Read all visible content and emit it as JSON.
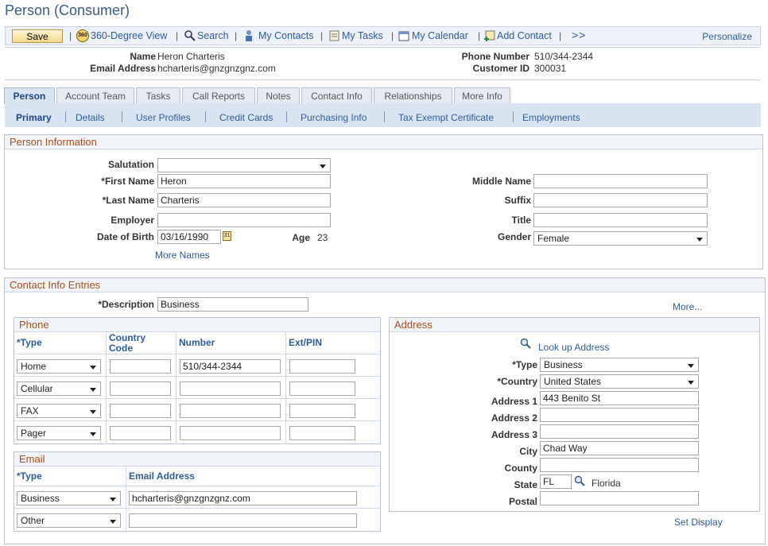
{
  "page": {
    "title": "Person (Consumer)"
  },
  "toolbar": {
    "save": "Save",
    "links": [
      {
        "label": "360-Degree View",
        "icon": "360-icon"
      },
      {
        "label": "Search",
        "icon": "search-icon"
      },
      {
        "label": "My Contacts",
        "icon": "contacts-icon"
      },
      {
        "label": "My Tasks",
        "icon": "tasks-icon"
      },
      {
        "label": "My Calendar",
        "icon": "calendar-icon"
      },
      {
        "label": "Add Contact",
        "icon": "add-contact-icon"
      }
    ],
    "more": ">>",
    "personalize": "Personalize"
  },
  "header": {
    "name_label": "Name",
    "name": "Heron Charteris",
    "email_label": "Email Address",
    "email": "hcharteris@gnzgnzgnz.com",
    "phone_label": "Phone Number",
    "phone": "510/344-2344",
    "customer_label": "Customer ID",
    "customer_id": "300031"
  },
  "tabs": [
    "Person",
    "Account Team",
    "Tasks",
    "Call Reports",
    "Notes",
    "Contact Info",
    "Relationships",
    "More Info"
  ],
  "subtabs": [
    "Primary",
    "Details",
    "User Profiles",
    "Credit Cards",
    "Purchasing Info",
    "Tax Exempt Certificate",
    "Employments"
  ],
  "person_info": {
    "heading": "Person Information",
    "salutation_label": "Salutation",
    "salutation": "",
    "first_name_label": "*First Name",
    "first_name": "Heron",
    "last_name_label": "*Last Name",
    "last_name": "Charteris",
    "employer_label": "Employer",
    "employer": "",
    "dob_label": "Date of Birth",
    "dob": "03/16/1990",
    "age_label": "Age",
    "age": "23",
    "more_names": "More Names",
    "middle_name_label": "Middle Name",
    "middle_name": "",
    "suffix_label": "Suffix",
    "suffix": "",
    "title_label": "Title",
    "title": "",
    "gender_label": "Gender",
    "gender": "Female"
  },
  "contact_info": {
    "heading": "Contact Info Entries",
    "description_label": "*Description",
    "description": "Business",
    "more": "More...",
    "phone": {
      "heading": "Phone",
      "headers": [
        "*Type",
        "Country Code",
        "Number",
        "Ext/PIN"
      ],
      "rows": [
        {
          "type": "Home",
          "country_code": "",
          "number": "510/344-2344",
          "ext": ""
        },
        {
          "type": "Cellular",
          "country_code": "",
          "number": "",
          "ext": ""
        },
        {
          "type": "FAX",
          "country_code": "",
          "number": "",
          "ext": ""
        },
        {
          "type": "Pager",
          "country_code": "",
          "number": "",
          "ext": ""
        }
      ]
    },
    "email": {
      "heading": "Email",
      "headers": [
        "*Type",
        "Email Address"
      ],
      "rows": [
        {
          "type": "Business",
          "address": "hcharteris@gnzgnzgnz.com"
        },
        {
          "type": "Other",
          "address": ""
        }
      ]
    },
    "address": {
      "heading": "Address",
      "lookup": "Look up Address",
      "type_label": "*Type",
      "type": "Business",
      "country_label": "*Country",
      "country": "United States",
      "address1_label": "Address 1",
      "address1": "443 Benito St",
      "address2_label": "Address 2",
      "address2": "",
      "address3_label": "Address 3",
      "address3": "",
      "city_label": "City",
      "city": "Chad Way",
      "county_label": "County",
      "county": "",
      "state_label": "State",
      "state": "FL",
      "state_name": "Florida",
      "postal_label": "Postal",
      "postal": ""
    },
    "set_display": "Set Display"
  }
}
